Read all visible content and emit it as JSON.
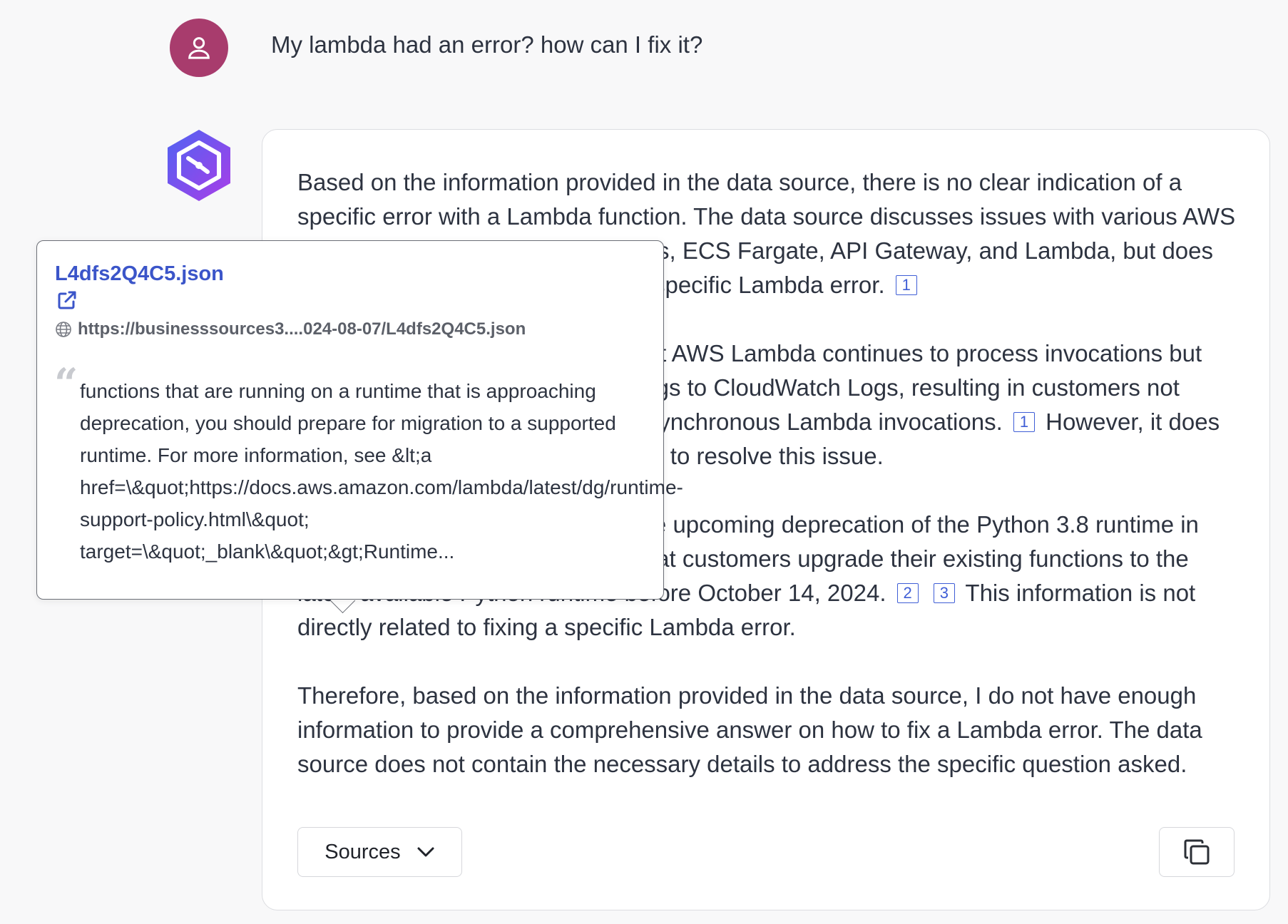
{
  "user": {
    "question": "My lambda had an error? how can I fix it?",
    "avatar_icon": "user-icon",
    "avatar_color": "#a83c6d"
  },
  "assistant": {
    "avatar_icon": "hexagon-clock-logo-icon",
    "paragraphs": [
      {
        "parts": [
          {
            "type": "text",
            "value": "Based on the information provided in the data source, there is no clear indication of a specific error with a Lambda function. The data source discusses issues with various AWS services, such as CloudWatch Logs, ECS Fargate, API Gateway, and Lambda, but does not provide details on how to fix a specific Lambda error."
          },
          {
            "type": "cite",
            "value": "1"
          }
        ]
      },
      {
        "parts": [
          {
            "type": "text",
            "value": "One of the issues mentioned is that AWS Lambda continues to process invocations but experiences delays in delivering logs to CloudWatch Logs, resulting in customers not seeing logs for a portion of their asynchronous Lambda invocations."
          },
          {
            "type": "cite",
            "value": "1"
          },
          {
            "type": "text",
            "value": "However, it does not provide any information on how to resolve this issue."
          }
        ]
      },
      {
        "parts": [
          {
            "type": "text",
            "value": "The data source also discusses the upcoming deprecation of the Python 3.8 runtime in AWS Lambda and recommends that customers upgrade their existing functions to the latest available Python runtime before October 14, 2024."
          },
          {
            "type": "cite",
            "value": "2"
          },
          {
            "type": "cite",
            "value": "3"
          },
          {
            "type": "text",
            "value": "This information is not directly related to fixing a specific Lambda error."
          }
        ]
      },
      {
        "parts": [
          {
            "type": "text",
            "value": "Therefore, based on the information provided in the data source, I do not have enough information to provide a comprehensive answer on how to fix a Lambda error. The data source does not contain the necessary details to address the specific question asked."
          }
        ]
      }
    ],
    "sources_label": "Sources",
    "sources_icon": "chevron-down-icon",
    "copy_icon": "copy-icon"
  },
  "popover": {
    "title": "L4dfs2Q4C5.json",
    "external_link_icon": "external-link-icon",
    "globe_icon": "globe-icon",
    "url": "https://businesssources3....024-08-07/L4dfs2Q4C5.json",
    "quote_mark": "“",
    "excerpt": "functions that are running on a runtime that is approaching deprecation, you should prepare for migration to a supported runtime. For more information, see &lt;a href=\\&quot;https://docs.aws.amazon.com/lambda/latest/dg/runtime-support-policy.html\\&quot; target=\\&quot;_blank\\&quot;&gt;Runtime..."
  },
  "colors": {
    "citation": "#3f5ed6",
    "link": "#3b55c9",
    "logo_gradient_start": "#5b5ef0",
    "logo_gradient_end": "#a540e6"
  }
}
